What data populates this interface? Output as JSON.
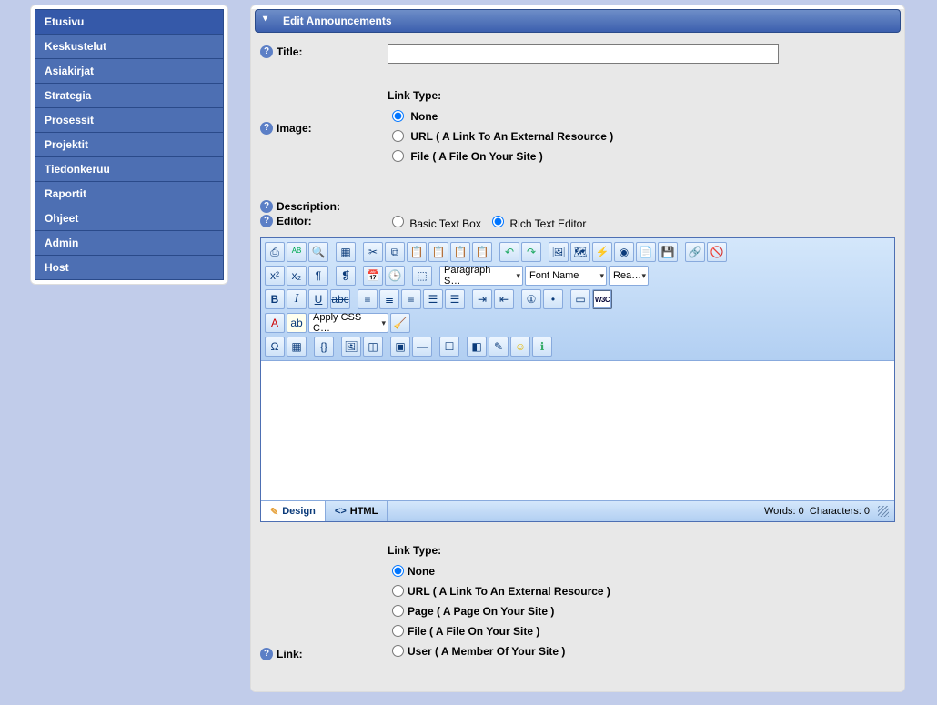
{
  "sidebar": {
    "items": [
      {
        "label": "Etusivu",
        "name": "sidebar-item-etusivu",
        "active": true
      },
      {
        "label": "Keskustelut",
        "name": "sidebar-item-keskustelut",
        "active": false
      },
      {
        "label": "Asiakirjat",
        "name": "sidebar-item-asiakirjat",
        "active": false
      },
      {
        "label": "Strategia",
        "name": "sidebar-item-strategia",
        "active": false
      },
      {
        "label": "Prosessit",
        "name": "sidebar-item-prosessit",
        "active": false
      },
      {
        "label": "Projektit",
        "name": "sidebar-item-projektit",
        "active": false
      },
      {
        "label": "Tiedonkeruu",
        "name": "sidebar-item-tiedonkeruu",
        "active": false
      },
      {
        "label": "Raportit",
        "name": "sidebar-item-raportit",
        "active": false
      },
      {
        "label": "Ohjeet",
        "name": "sidebar-item-ohjeet",
        "active": false
      },
      {
        "label": "Admin",
        "name": "sidebar-item-admin",
        "active": false
      },
      {
        "label": "Host",
        "name": "sidebar-item-host",
        "active": false
      }
    ]
  },
  "panel": {
    "title": "Edit Announcements"
  },
  "form": {
    "title_label": "Title:",
    "title_value": "",
    "image_label": "Image:",
    "description_label": "Description:",
    "editor_label": "Editor:",
    "link_label": "Link:",
    "link_type_heading": "Link Type:",
    "editor_options": {
      "basic": "Basic Text Box",
      "rich": "Rich Text Editor"
    },
    "image_link_type_options": {
      "none": "None",
      "url": "URL ( A Link To An External Resource )",
      "file": "File ( A File On Your Site )"
    },
    "link_type_options": {
      "none": "None",
      "url": "URL ( A Link To An External Resource )",
      "page": "Page ( A Page On Your Site )",
      "file": "File ( A File On Your Site )",
      "user": "User ( A Member Of Your Site )"
    }
  },
  "rte": {
    "tabs": {
      "design": "Design",
      "html": "HTML"
    },
    "status": {
      "words_label": "Words:",
      "words": "0",
      "chars_label": "Characters:",
      "chars": "0"
    },
    "combos": {
      "paragraph": "Paragraph S…",
      "font_name": "Font Name",
      "font_size": "Rea…",
      "css_class": "Apply CSS C…"
    }
  }
}
